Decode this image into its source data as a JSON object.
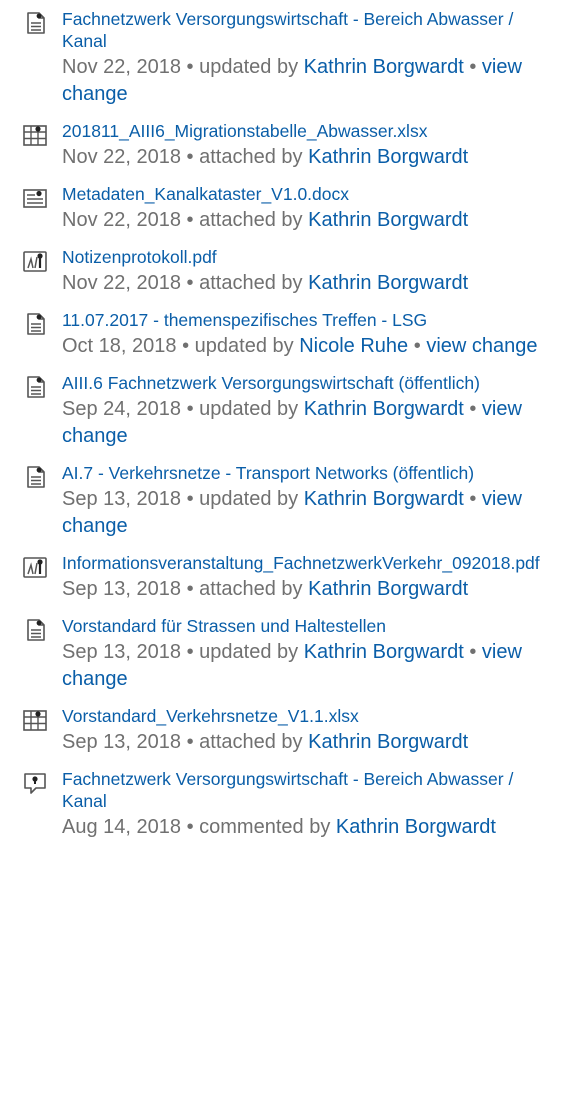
{
  "items": [
    {
      "icon": "page-icon",
      "title": "Fachnetzwerk Versorgungswirtschaft - Bereich Abwasser / Kanal",
      "date": "Nov 22, 2018",
      "action": "updated by",
      "author": "Kathrin Borgwardt",
      "change": "view change"
    },
    {
      "icon": "spreadsheet-icon",
      "title": "201811_AIII6_Migrationstabelle_Abwasser.xlsx",
      "date": "Nov 22, 2018",
      "action": "attached by",
      "author": "Kathrin Borgwardt",
      "change": ""
    },
    {
      "icon": "document-icon",
      "title": "Metadaten_Kanalkataster_V1.0.docx",
      "date": "Nov 22, 2018",
      "action": "attached by",
      "author": "Kathrin Borgwardt",
      "change": ""
    },
    {
      "icon": "pdf-icon",
      "title": "Notizenprotokoll.pdf",
      "date": "Nov 22, 2018",
      "action": "attached by",
      "author": "Kathrin Borgwardt",
      "change": ""
    },
    {
      "icon": "page-icon",
      "title": "11.07.2017 - themenspezifisches Treffen - LSG",
      "date": "Oct 18, 2018",
      "action": "updated by",
      "author": "Nicole Ruhe",
      "change": "view change"
    },
    {
      "icon": "page-icon",
      "title": "AIII.6 Fachnetzwerk Versorgungswirtschaft (öffentlich)",
      "date": "Sep 24, 2018",
      "action": "updated by",
      "author": "Kathrin Borgwardt",
      "change": "view change"
    },
    {
      "icon": "page-icon",
      "title": "AI.7 - Verkehrsnetze - Transport Networks (öffentlich)",
      "date": "Sep 13, 2018",
      "action": "updated by",
      "author": "Kathrin Borgwardt",
      "change": "view change"
    },
    {
      "icon": "pdf-icon",
      "title": "Informationsveranstaltung_FachnetzwerkVerkehr_092018.pdf",
      "date": "Sep 13, 2018",
      "action": "attached by",
      "author": "Kathrin Borgwardt",
      "change": ""
    },
    {
      "icon": "page-icon",
      "title": "Vorstandard für Strassen und Haltestellen",
      "date": "Sep 13, 2018",
      "action": "updated by",
      "author": "Kathrin Borgwardt",
      "change": "view change"
    },
    {
      "icon": "spreadsheet-icon",
      "title": "Vorstandard_Verkehrsnetze_V1.1.xlsx",
      "date": "Sep 13, 2018",
      "action": "attached by",
      "author": "Kathrin Borgwardt",
      "change": ""
    },
    {
      "icon": "comment-icon",
      "title": "Fachnetzwerk Versorgungswirtschaft - Bereich Abwasser / Kanal",
      "date": "Aug 14, 2018",
      "action": "commented by",
      "author": "Kathrin Borgwardt",
      "change": ""
    }
  ],
  "separator": "•",
  "colors": {
    "link": "#0a5ea8",
    "text": "#707070",
    "icon_stroke": "#555555"
  }
}
